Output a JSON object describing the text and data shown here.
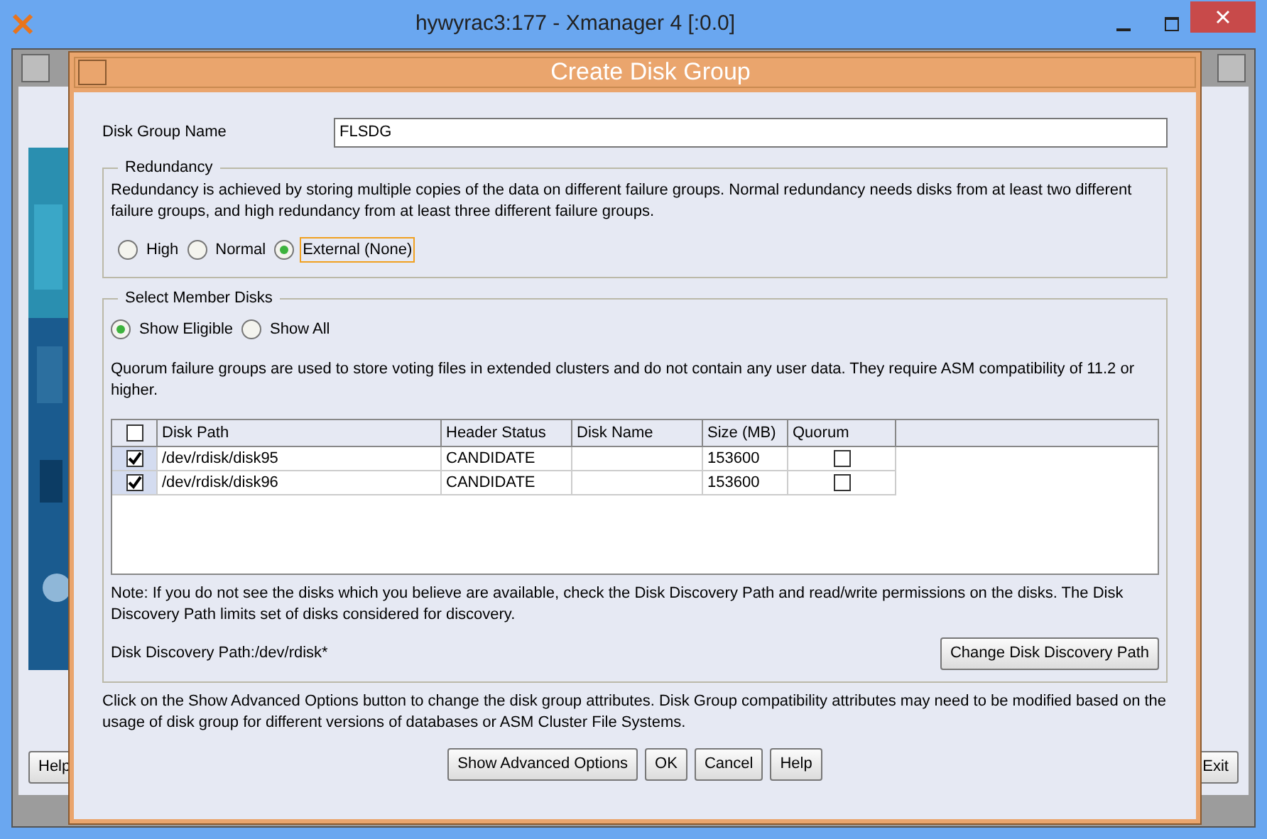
{
  "window": {
    "title": "hywyrac3:177 - Xmanager 4 [:0.0]"
  },
  "background_window": {
    "buttons": [
      "Help",
      "Exit"
    ]
  },
  "dialog": {
    "title": "Create Disk Group",
    "name_label": "Disk Group Name",
    "name_value": "FLSDG",
    "redundancy": {
      "legend": "Redundancy",
      "description": "Redundancy is achieved by storing multiple copies of the data on different failure groups. Normal redundancy needs disks from at least two different failure groups, and high redundancy from at least three different failure groups.",
      "options": [
        {
          "label": "High",
          "selected": false,
          "focused": false
        },
        {
          "label": "Normal",
          "selected": false,
          "focused": false
        },
        {
          "label": "External (None)",
          "selected": true,
          "focused": true
        }
      ]
    },
    "member_disks": {
      "legend": "Select Member Disks",
      "filters": [
        {
          "label": "Show Eligible",
          "selected": true,
          "focused": false
        },
        {
          "label": "Show All",
          "selected": false,
          "focused": false
        }
      ],
      "quorum_note": "Quorum failure groups are used to store voting files in extended clusters and do not contain any user data. They require ASM compatibility of 11.2 or higher.",
      "table": {
        "select_all_checked": false,
        "columns": [
          "Disk Path",
          "Header Status",
          "Disk Name",
          "Size (MB)",
          "Quorum"
        ],
        "rows": [
          {
            "checked": true,
            "disk_path": "/dev/rdisk/disk95",
            "header_status": "CANDIDATE",
            "disk_name": "",
            "size": "153600",
            "quorum": false
          },
          {
            "checked": true,
            "disk_path": "/dev/rdisk/disk96",
            "header_status": "CANDIDATE",
            "disk_name": "",
            "size": "153600",
            "quorum": false
          }
        ]
      },
      "note": "Note: If you do not see the disks which you believe are available, check the Disk Discovery Path and read/write permissions on the disks. The Disk Discovery Path limits set of disks considered for discovery.",
      "discovery_path": "Disk Discovery Path:/dev/rdisk*",
      "change_path_button": "Change Disk Discovery Path"
    },
    "advanced_note": "Click on the Show Advanced Options button to change the disk group attributes. Disk Group compatibility attributes may need to be modified based on the usage of disk group for different versions of databases or ASM Cluster File Systems.",
    "buttons": [
      "Show Advanced Options",
      "OK",
      "Cancel",
      "Help"
    ]
  }
}
